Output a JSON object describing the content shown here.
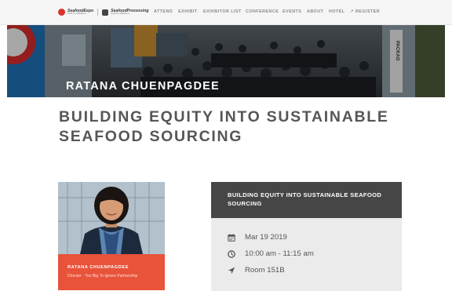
{
  "header": {
    "logos": [
      {
        "line1": "SeafoodExpo",
        "line2": "NORTH AMERICA"
      },
      {
        "line1": "SeafoodProcessing",
        "line2": "NORTH AMERICA"
      }
    ],
    "nav": [
      {
        "label": "ATTEND"
      },
      {
        "label": "EXHIBIT"
      },
      {
        "label": "EXHIBITOR LIST"
      },
      {
        "label": "CONFERENCE"
      },
      {
        "label": "EVENTS"
      },
      {
        "label": "ABOUT"
      },
      {
        "label": "HOTEL"
      },
      {
        "label": "REGISTER",
        "icon": "external-arrow-icon"
      }
    ]
  },
  "hero": {
    "title": "RATANA CHUENPAGDEE",
    "sign_text": "PACKAG"
  },
  "page": {
    "title": "BUILDING EQUITY INTO SUSTAINABLE SEAFOOD SOURCING"
  },
  "speaker": {
    "name": "RATANA CHUENPAGDEE",
    "role": "Director - Too Big To Ignore Partnership"
  },
  "session": {
    "title": "BUILDING EQUITY INTO SUSTAINABLE SEAFOOD SOURCING",
    "date": "Mar 19 2019",
    "time": "10:00 am - 11:15 am",
    "room": "Room 151B",
    "icons": {
      "date": "calendar-icon",
      "time": "clock-icon",
      "room": "location-arrow-icon"
    }
  },
  "colors": {
    "accent": "#e8533a",
    "header_dark": "#464646",
    "session_bg": "#ebebeb",
    "title_text": "#565656"
  }
}
